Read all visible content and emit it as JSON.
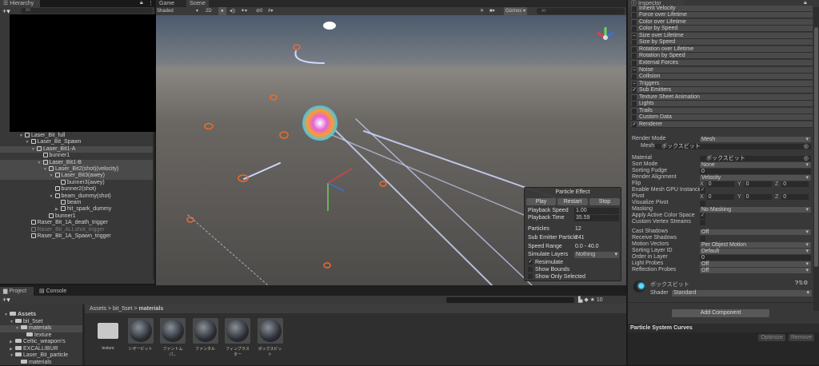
{
  "hierarchy": {
    "tab": "Hierarchy",
    "search_placeholder": "All",
    "items": [
      {
        "label": "Laser_Bit_full",
        "depth": 0,
        "arrow": "▼"
      },
      {
        "label": "Laser_Bit_Spawn",
        "depth": 1,
        "arrow": "▼"
      },
      {
        "label": "Laser_Bit1-A",
        "depth": 2,
        "arrow": "▼",
        "selected": true
      },
      {
        "label": "bunner1",
        "depth": 3,
        "arrow": ""
      },
      {
        "label": "Laser_Bit1-B",
        "depth": 3,
        "arrow": "▼",
        "selected": true
      },
      {
        "label": "Laser_Bit2(shot)(velocity)",
        "depth": 4,
        "arrow": "▼",
        "selected": true
      },
      {
        "label": "Laser_Bit3(awey)",
        "depth": 5,
        "arrow": "▼",
        "selected": true
      },
      {
        "label": "bunner3(awey)",
        "depth": 6,
        "arrow": ""
      },
      {
        "label": "bunner2(shot)",
        "depth": 5,
        "arrow": ""
      },
      {
        "label": "beam_dummy(shot)",
        "depth": 5,
        "arrow": "▼"
      },
      {
        "label": "beam",
        "depth": 6,
        "arrow": ""
      },
      {
        "label": "hit_spark_dummy",
        "depth": 6,
        "arrow": "▶"
      },
      {
        "label": "bunner1",
        "depth": 4,
        "arrow": ""
      },
      {
        "label": "Raser_Bit_1A_death_trigger",
        "depth": 1,
        "arrow": ""
      },
      {
        "label": "Raser_Bit_ALLshot_trigger",
        "depth": 1,
        "arrow": "",
        "dim": true
      },
      {
        "label": "Raser_Bit_1A_Spawn_trigger",
        "depth": 1,
        "arrow": ""
      }
    ]
  },
  "scene": {
    "tabs": [
      "Game",
      "Scene"
    ],
    "active_tab": "Scene",
    "shading": "Shaded",
    "mode_2d": "2D",
    "hidden_count": "0",
    "gizmos": "Gizmos",
    "search_placeholder": "All"
  },
  "particle_effect": {
    "title": "Particle Effect",
    "buttons": [
      "Play",
      "Restart",
      "Stop"
    ],
    "playback_speed_label": "Playback Speed",
    "playback_speed": "1.00",
    "playback_time_label": "Playback Time",
    "playback_time": "35.59",
    "particles_label": "Particles",
    "particles": "12",
    "sub_emitter_label": "Sub Emitter Particle",
    "sub_emitter": "241",
    "speed_range_label": "Speed Range",
    "speed_range": "0.0 - 40.0",
    "simulate_layers_label": "Simulate Layers",
    "simulate_layers": "Nothing",
    "options": [
      {
        "label": "Resimulate",
        "checked": true
      },
      {
        "label": "Show Bounds",
        "checked": false
      },
      {
        "label": "Show Only Selected",
        "checked": false
      }
    ]
  },
  "inspector": {
    "tab": "Inspector",
    "modules": [
      {
        "label": "Limit Velocity over Lifetime",
        "state": ""
      },
      {
        "label": "Inherit Velocity",
        "state": ""
      },
      {
        "label": "Force over Lifetime",
        "state": ""
      },
      {
        "label": "Color over Lifetime",
        "state": ""
      },
      {
        "label": "Color by Speed",
        "state": ""
      },
      {
        "label": "Size over Lifetime",
        "state": "–"
      },
      {
        "label": "Size by Speed",
        "state": ""
      },
      {
        "label": "Rotation over Lifetime",
        "state": ""
      },
      {
        "label": "Rotation by Speed",
        "state": ""
      },
      {
        "label": "External Forces",
        "state": ""
      },
      {
        "label": "Noise",
        "state": "–"
      },
      {
        "label": "Collision",
        "state": ""
      },
      {
        "label": "Triggers",
        "state": "–"
      },
      {
        "label": "Sub Emitters",
        "state": "✓"
      },
      {
        "label": "Texture Sheet Animation",
        "state": ""
      },
      {
        "label": "Lights",
        "state": ""
      },
      {
        "label": "Trails",
        "state": ""
      },
      {
        "label": "Custom Data",
        "state": ""
      },
      {
        "label": "Renderer",
        "state": "✓"
      }
    ],
    "render_mode_label": "Render Mode",
    "render_mode": "Mesh",
    "mesh_label": "Mesh",
    "mesh": "ボックスビット",
    "material_label": "Material",
    "material": "ボックスビット",
    "sort_mode_label": "Sort Mode",
    "sort_mode": "None",
    "sorting_fudge_label": "Sorting Fudge",
    "sorting_fudge": "0",
    "render_alignment_label": "Render Alignment",
    "render_alignment": "Velocity",
    "flip_label": "Flip",
    "flip": {
      "x": "0",
      "y": "0",
      "z": "0"
    },
    "gpu_instancing_label": "Enable Mesh GPU Instancing",
    "gpu_instancing": true,
    "pivot_label": "Pivot",
    "pivot": {
      "x": "0",
      "y": "0",
      "z": "0"
    },
    "visualize_pivot_label": "Visualize Pivot",
    "visualize_pivot": false,
    "masking_label": "Masking",
    "masking": "No Masking",
    "color_space_label": "Apply Active Color Space",
    "color_space": true,
    "vertex_streams_label": "Custom Vertex Streams",
    "vertex_streams": false,
    "cast_shadows_label": "Cast Shadows",
    "cast_shadows": "Off",
    "receive_shadows_label": "Receive Shadows",
    "receive_shadows": false,
    "motion_vectors_label": "Motion Vectors",
    "motion_vectors": "Per Object Motion",
    "sorting_layer_label": "Sorting Layer ID",
    "sorting_layer": "Default",
    "order_label": "Order in Layer",
    "order": "0",
    "light_probes_label": "Light Probes",
    "light_probes": "Off",
    "reflection_probes_label": "Reflection Probes",
    "reflection_probes": "Off",
    "material_name": "ボックスビット",
    "shader_label": "Shader",
    "shader": "Standard",
    "add_component": "Add Component",
    "curves_title": "Particle System Curves",
    "optimize": "Optimize",
    "remove": "Remove",
    "axis_labels": [
      "X",
      "Y",
      "Z"
    ]
  },
  "project": {
    "tabs": [
      "Project",
      "Console"
    ],
    "visible_count": "10",
    "breadcrumb": [
      "Assets",
      "bit_5set",
      "materials"
    ],
    "tree": [
      {
        "label": "Assets",
        "depth": 0,
        "arrow": "▼",
        "bold": true
      },
      {
        "label": "bit_5set",
        "depth": 1,
        "arrow": "▼"
      },
      {
        "label": "materials",
        "depth": 2,
        "arrow": "▼",
        "selected": true
      },
      {
        "label": "texture",
        "depth": 3,
        "arrow": ""
      },
      {
        "label": "Celtic_weapom's",
        "depth": 1,
        "arrow": "▶"
      },
      {
        "label": "EXCALLIBUR",
        "depth": 1,
        "arrow": "▶"
      },
      {
        "label": "Laser_Bit_particle",
        "depth": 1,
        "arrow": "▼"
      },
      {
        "label": "materials",
        "depth": 2,
        "arrow": ""
      }
    ],
    "assets": [
      {
        "label": "texture",
        "type": "folder"
      },
      {
        "label": "シザービット",
        "type": "material"
      },
      {
        "label": "ファントムパ...",
        "type": "material"
      },
      {
        "label": "ファンネル",
        "type": "material"
      },
      {
        "label": "フィンブラスター",
        "type": "material"
      },
      {
        "label": "ボックスビット",
        "type": "material"
      }
    ]
  }
}
